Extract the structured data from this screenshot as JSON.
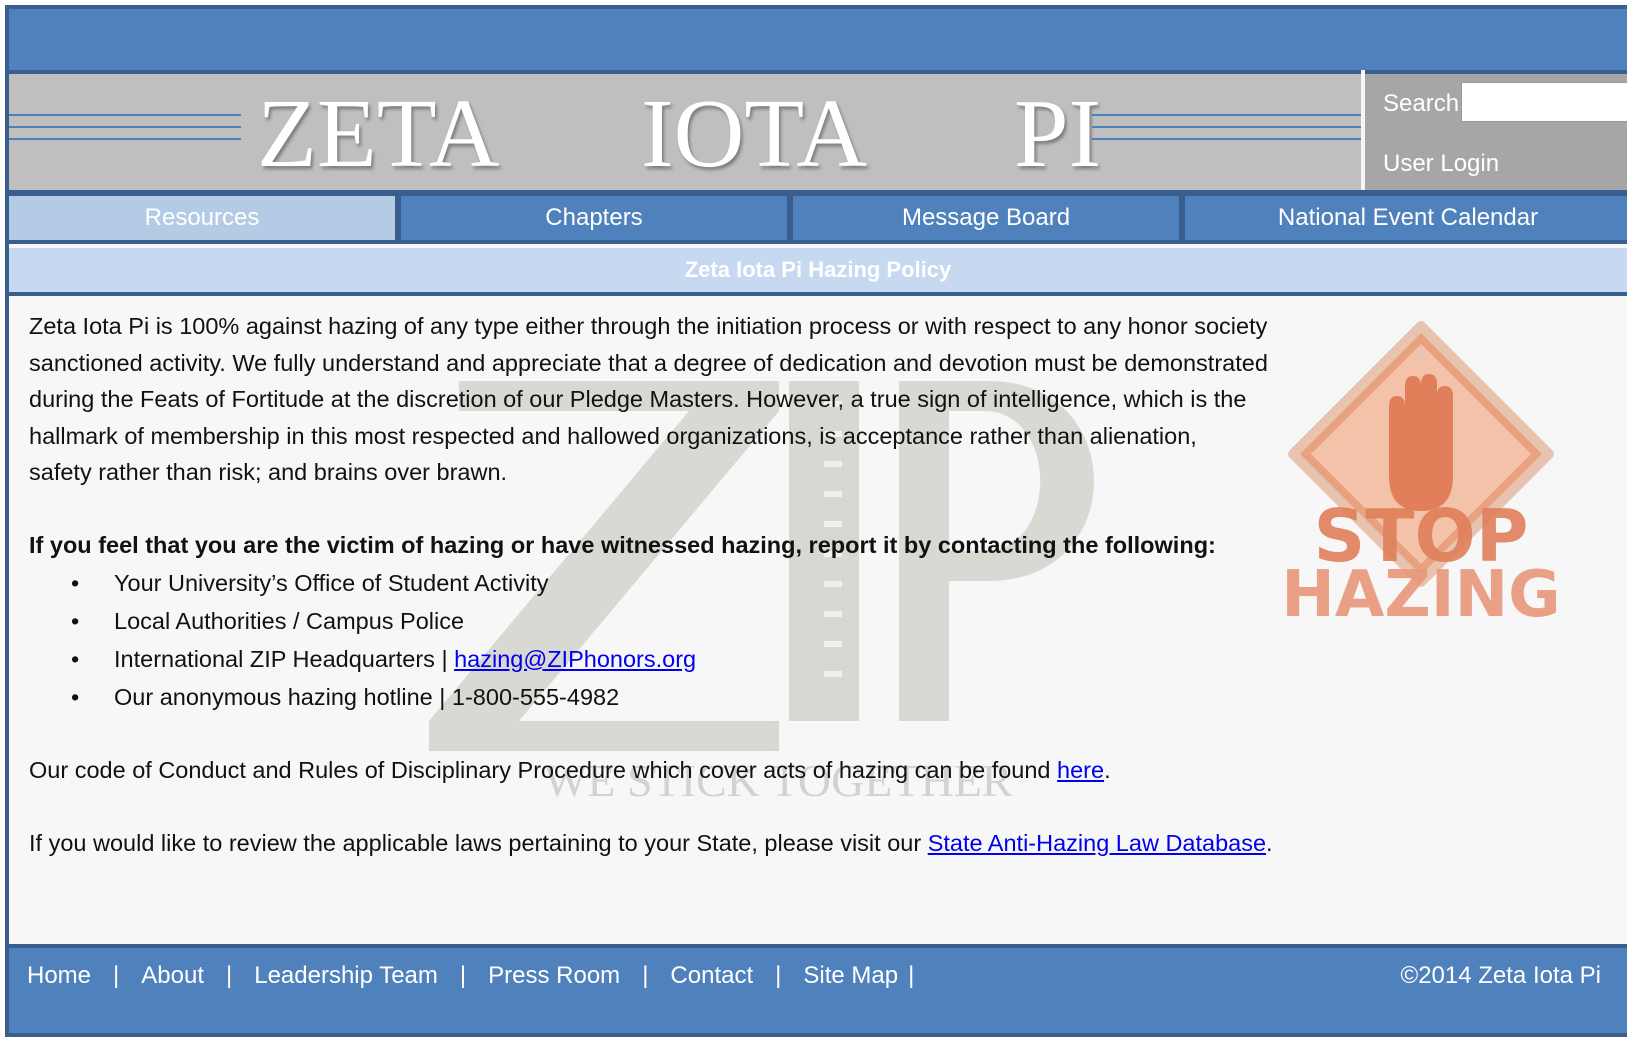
{
  "header": {
    "logo_words": [
      "ZETA",
      "IOTA",
      "PI"
    ],
    "search_label": "Search",
    "search_value": "",
    "login_label": "User Login"
  },
  "nav": {
    "items": [
      {
        "label": "Resources",
        "active": true
      },
      {
        "label": "Chapters",
        "active": false
      },
      {
        "label": "Message Board",
        "active": false
      },
      {
        "label": "National Event Calendar",
        "active": false
      }
    ]
  },
  "section_title": "Zeta Iota Pi Hazing Policy",
  "content": {
    "intro_lines": [
      "Zeta Iota Pi is 100% against hazing of any type either through the initiation process or with respect to any honor society",
      "sanctioned activity. We fully understand and appreciate that a degree of dedication and devotion must be demonstrated",
      "during the Feats of Fortitude at the discretion of our Pledge Masters. However, a true sign of intelligence, which is the",
      "hallmark of membership in this most respected and hallowed organizations, is acceptance rather than alienation,",
      "safety rather than risk; and brains over brawn."
    ],
    "report_heading": "If you feel that you are the victim of hazing or have witnessed hazing, report it by contacting the following:",
    "report_items": {
      "item1": "Your University’s Office of Student Activity",
      "item2": "Local Authorities / Campus Police",
      "item3_prefix": "International ZIP Headquarters | ",
      "item3_link": "hazing@ZIPhonors.org",
      "item4": "Our anonymous hazing hotline | 1-800-555-4982"
    },
    "conduct_text": "Our code of Conduct and Rules of Disciplinary Procedure which cover acts of hazing can be found ",
    "conduct_link": "here",
    "laws_text": "If you would like to review the applicable laws pertaining to your State, please visit our ",
    "laws_link": "State Anti-Hazing Law Database",
    "watermark_letters": "ZIP",
    "watermark_motto": "WE STICK TOGETHER",
    "stop_sign_text": [
      "STOP",
      "HAZING"
    ]
  },
  "footer": {
    "links": [
      "Home",
      "About",
      "Leadership Team",
      "Press Room",
      "Contact",
      "Site Map"
    ],
    "separator": "|",
    "copyright": "©2014 Zeta Iota Pi"
  },
  "colors": {
    "primary_blue": "#4f81bd",
    "dark_blue": "#3a5f8f",
    "light_blue": "#c6d9f0",
    "header_gray": "#bfbfbf",
    "stop_orange": "#e07f5a"
  }
}
